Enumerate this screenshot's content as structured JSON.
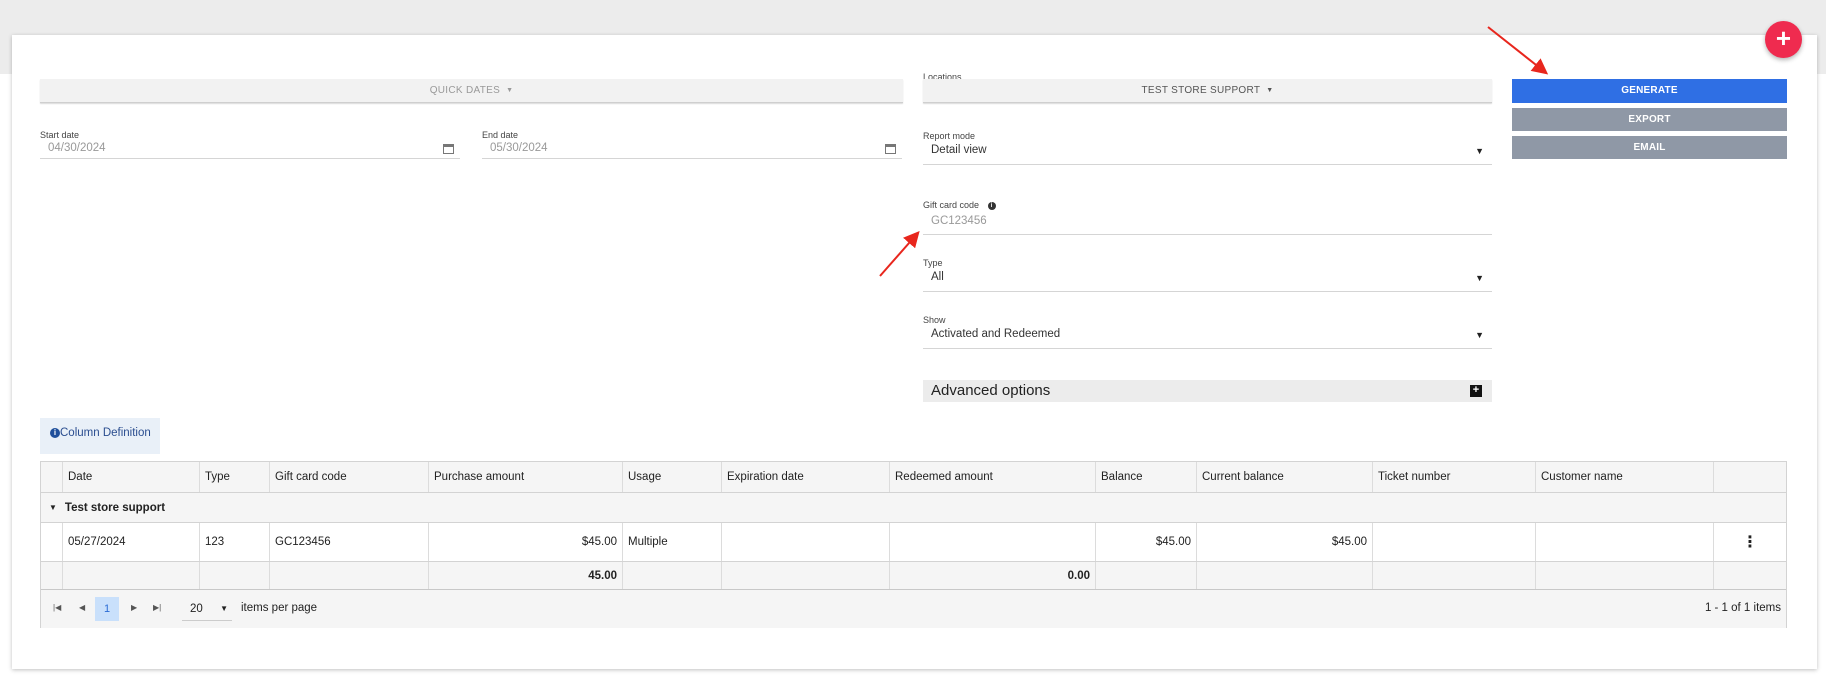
{
  "fab": {
    "label": "+"
  },
  "filters": {
    "quick_dates": "QUICK DATES",
    "start_date": {
      "label": "Start date",
      "value": "04/30/2024"
    },
    "end_date": {
      "label": "End date",
      "value": "05/30/2024"
    },
    "locations": {
      "label": "Locations",
      "value": "TEST STORE SUPPORT"
    },
    "report_mode": {
      "label": "Report mode",
      "value": "Detail view"
    },
    "gift_card_code": {
      "label": "Gift card code",
      "placeholder": "GC123456"
    },
    "type": {
      "label": "Type",
      "value": "All"
    },
    "show": {
      "label": "Show",
      "value": "Activated and Redeemed"
    },
    "advanced_options": "Advanced options"
  },
  "actions": {
    "generate": "GENERATE",
    "export": "EXPORT",
    "email": "EMAIL"
  },
  "column_definition": "Column Definition",
  "table": {
    "headers": [
      "Date",
      "Type",
      "Gift card code",
      "Purchase amount",
      "Usage",
      "Expiration date",
      "Redeemed amount",
      "Balance",
      "Current balance",
      "Ticket number",
      "Customer name"
    ],
    "group_label": "Test store support",
    "rows": [
      {
        "date": "05/27/2024",
        "type": "123",
        "gift_card_code": "GC123456",
        "purchase_amount": "$45.00",
        "usage": "Multiple",
        "expiration_date": "",
        "redeemed_amount": "",
        "balance": "$45.00",
        "current_balance": "$45.00",
        "ticket_number": "",
        "customer_name": ""
      }
    ],
    "totals": {
      "purchase_amount": "45.00",
      "redeemed_amount": "0.00"
    }
  },
  "pager": {
    "current_page": "1",
    "page_size": "20",
    "items_per_page_label": "items per page",
    "summary": "1 - 1 of 1 items"
  },
  "colors": {
    "primary": "#2f6fe4",
    "fab": "#ef2b4f",
    "annotation_arrow": "#e8261d"
  }
}
